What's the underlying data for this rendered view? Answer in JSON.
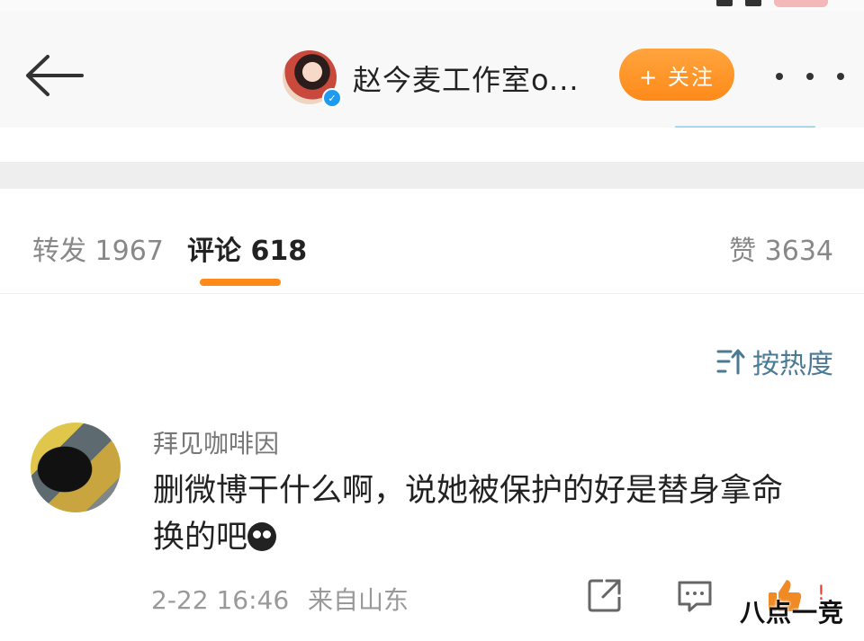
{
  "header": {
    "account_name": "赵今麦工作室o...",
    "follow_label": "+ 关注"
  },
  "tabs": {
    "repost": "转发 1967",
    "comment": "评论 618",
    "like": "赞 3634"
  },
  "sort": {
    "label": "按热度"
  },
  "comment": {
    "username": "拜见咖啡因",
    "text": "删微博干什么啊，说她被保护的好是替身拿命换的吧",
    "time": "2-22 16:46",
    "source": "来自山东"
  },
  "watermark": "八点一竞",
  "colors": {
    "accent": "#ff8a1a",
    "sort_text": "#4a7a94",
    "verified": "#1d9bf0"
  },
  "icons": [
    "back-arrow-icon",
    "verified-icon",
    "more-icon",
    "sort-icon",
    "share-icon",
    "reply-icon",
    "like-icon",
    "crying-emoji-icon"
  ]
}
